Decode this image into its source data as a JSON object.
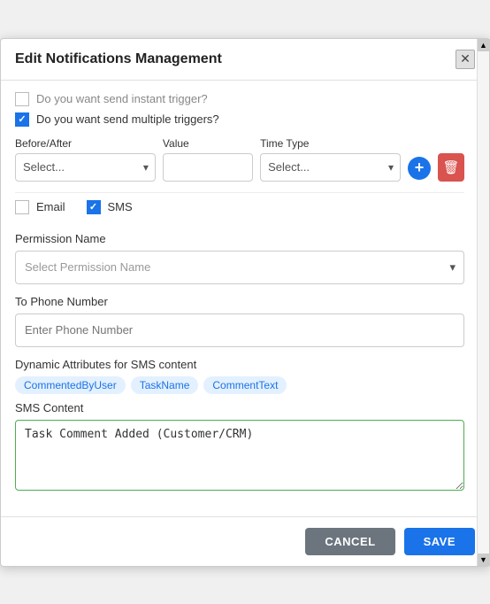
{
  "modal": {
    "title": "Edit Notifications Management",
    "close_label": "✕"
  },
  "checkboxes": {
    "instant_trigger_label": "Do you want send instant trigger?",
    "instant_trigger_checked": false,
    "multiple_triggers_label": "Do you want send multiple triggers?",
    "multiple_triggers_checked": true
  },
  "trigger_row": {
    "before_after_label": "Before/After",
    "value_label": "Value",
    "time_type_label": "Time Type",
    "before_after_placeholder": "Select...",
    "time_type_placeholder": "Select..."
  },
  "notification_channels": {
    "email_label": "Email",
    "email_checked": false,
    "sms_label": "SMS",
    "sms_checked": true
  },
  "permission_name": {
    "label": "Permission Name",
    "placeholder": "Select Permission Name"
  },
  "phone": {
    "label": "To Phone Number",
    "placeholder": "Enter Phone Number"
  },
  "dynamic_attrs": {
    "label": "Dynamic Attributes for SMS content",
    "tags": [
      "CommentedByUser",
      "TaskName",
      "CommentText"
    ]
  },
  "sms_content": {
    "label": "SMS Content",
    "value": "Task Comment Added (Customer/CRM)"
  },
  "footer": {
    "cancel_label": "CANCEL",
    "save_label": "SAVE"
  },
  "icons": {
    "close": "✕",
    "chevron_down": "▾",
    "plus": "+",
    "trash": "🗑",
    "check": "✓",
    "scroll_up": "▲",
    "scroll_down": "▼"
  }
}
